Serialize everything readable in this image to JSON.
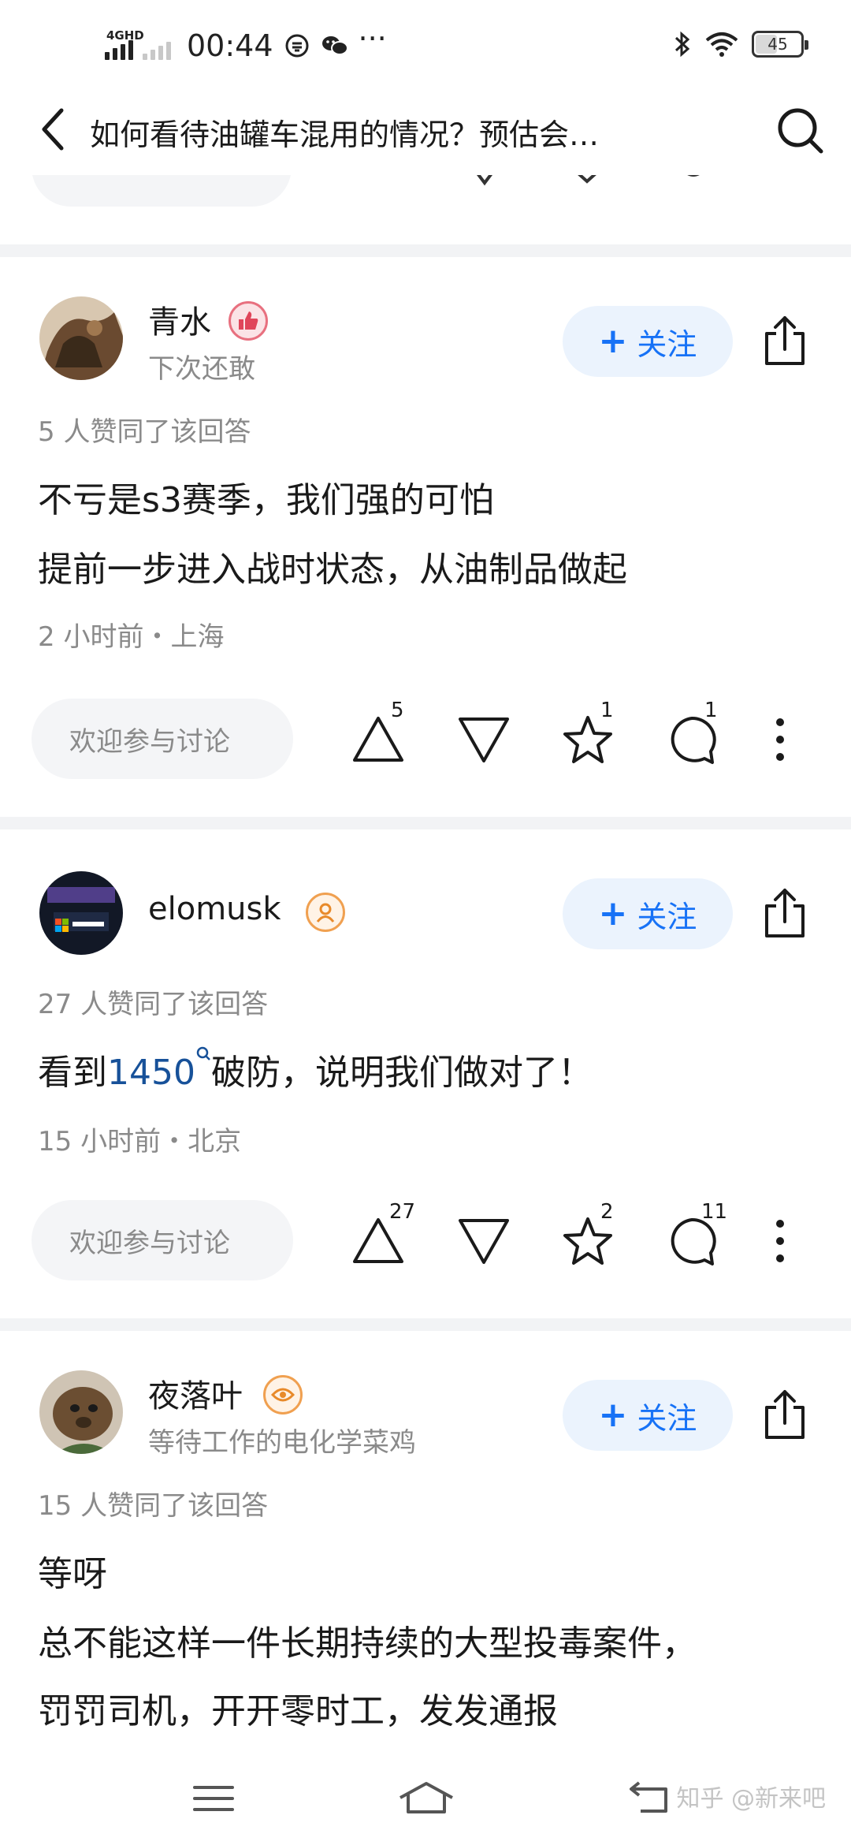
{
  "status_bar": {
    "network_label": "4GHD",
    "time": "00:44",
    "battery": "45",
    "battery_level": 0.45
  },
  "header": {
    "title": "如何看待油罐车混用的情况？预估会…"
  },
  "answers": [
    {
      "author": "青水",
      "bio": "下次还敢",
      "follow_label": "关注",
      "votes_text": "5 人赞同了该回答",
      "content": [
        "不亏是s3赛季，我们强的可怕",
        "提前一步进入战时状态，从油制品做起"
      ],
      "meta": "2 小时前・上海",
      "comment_placeholder": "欢迎参与讨论",
      "upvote_count": "5",
      "star_count": "1",
      "comment_count": "1"
    },
    {
      "author": "elomusk",
      "bio": "",
      "follow_label": "关注",
      "votes_text": "27 人赞同了该回答",
      "content_prefix": "看到",
      "content_link": "1450",
      "content_suffix": "破防，说明我们做对了！",
      "meta": "15 小时前・北京",
      "comment_placeholder": "欢迎参与讨论",
      "upvote_count": "27",
      "star_count": "2",
      "comment_count": "11"
    },
    {
      "author": "夜落叶",
      "bio": "等待工作的电化学菜鸡",
      "follow_label": "关注",
      "votes_text": "15 人赞同了该回答",
      "content": [
        "等呀",
        "总不能这样一件长期持续的大型投毒案件，",
        "罚罚司机，开开零时工，发发通报"
      ]
    }
  ],
  "watermark": "知乎 @新来吧",
  "colors": {
    "accent": "#1772f6",
    "follow_bg": "#ebf3fd",
    "link": "#175199",
    "secondary_text": "#8a8a8a",
    "divider": "#f2f3f5"
  }
}
